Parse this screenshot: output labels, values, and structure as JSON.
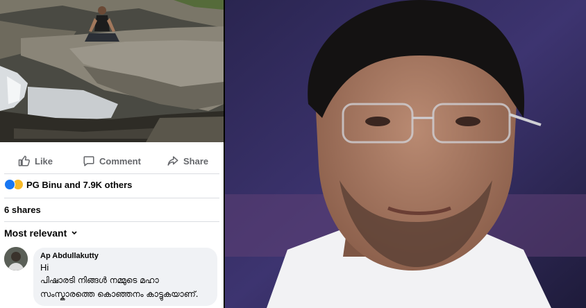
{
  "post": {
    "actions": {
      "like_label": "Like",
      "comment_label": "Comment",
      "share_label": "Share"
    },
    "reactions": {
      "icons": [
        "like-icon",
        "haha-icon"
      ],
      "summary": "PG Binu and 7.9K others"
    },
    "shares_text": "6 shares",
    "sort_label": "Most relevant"
  },
  "comment": {
    "author": "Ap Abdullakutty",
    "greeting": "Hi",
    "lines": [
      "പിഷാരടി നിങ്ങൾ നമ്മുടെ മഹാ",
      "സംസ്കാരത്തെ കൊഞ്ഞനം കാട്ടുകയാണ്."
    ]
  },
  "colors": {
    "facebook_blue": "#1877f2",
    "text_secondary": "#65676b",
    "bubble_bg": "#f0f2f5"
  }
}
